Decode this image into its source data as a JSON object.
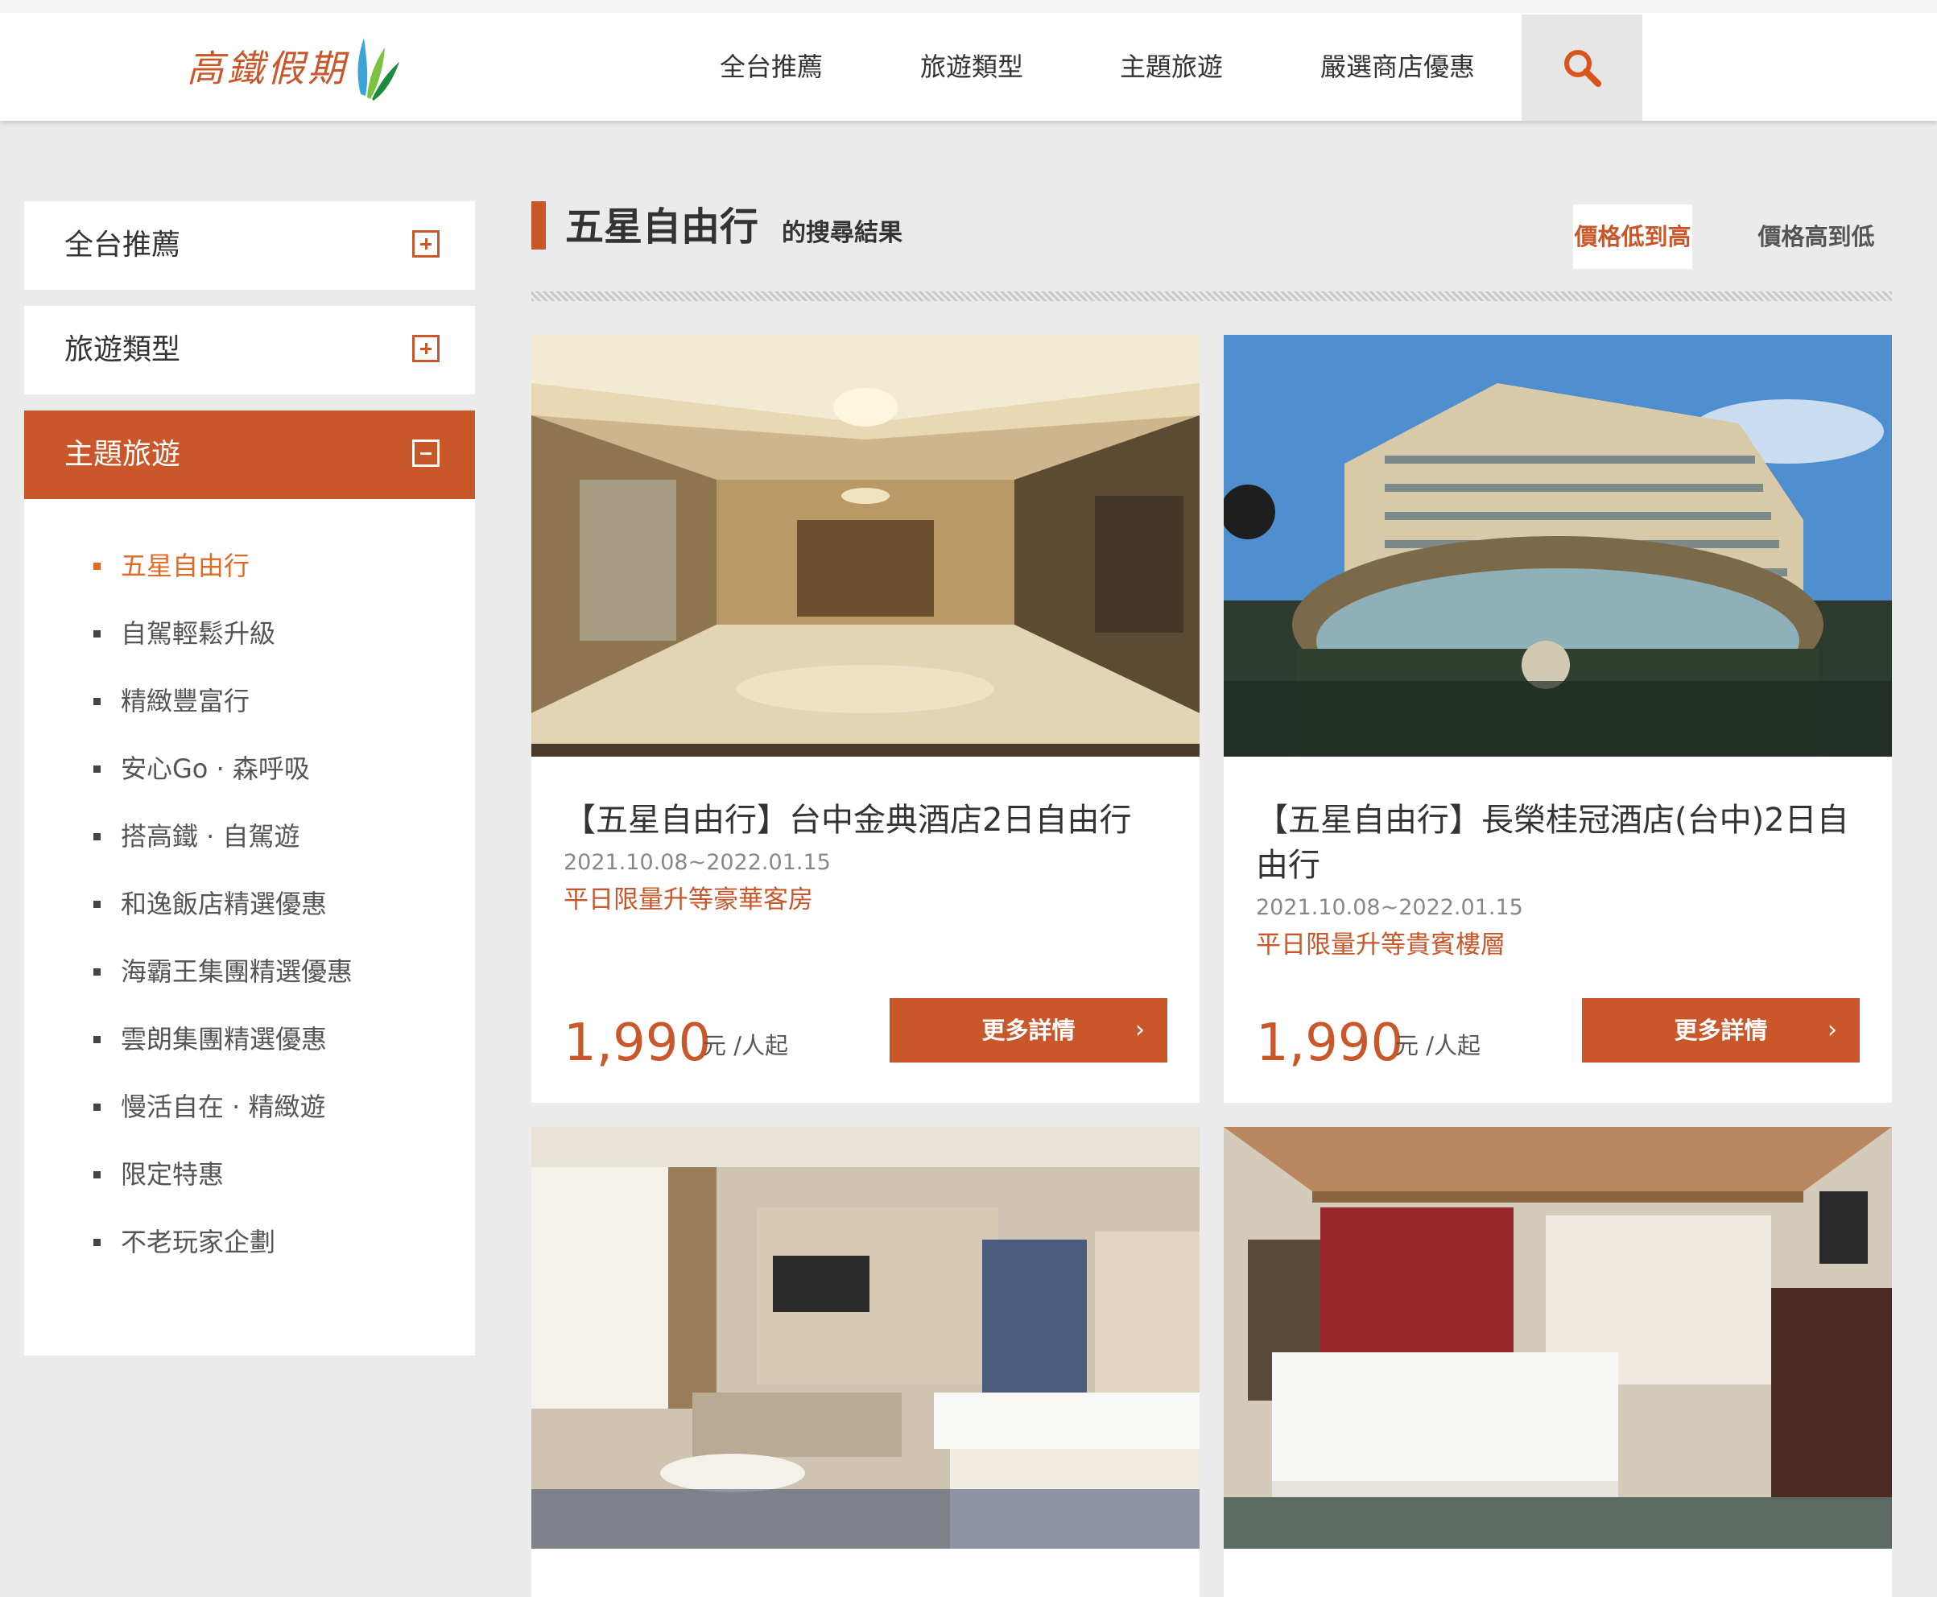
{
  "header": {
    "logo_text": "高鐵假期",
    "nav": [
      "全台推薦",
      "旅遊類型",
      "主題旅遊",
      "嚴選商店優惠"
    ],
    "search_icon": "search-icon",
    "accent_color": "#c9572a"
  },
  "sidebar": {
    "sections": [
      {
        "label": "全台推薦",
        "state": "collapsed"
      },
      {
        "label": "旅遊類型",
        "state": "collapsed"
      },
      {
        "label": "主題旅遊",
        "state": "expanded"
      }
    ],
    "sub_items": [
      "五星自由行",
      "自駕輕鬆升級",
      "精緻豐富行",
      "安心Go · 森呼吸",
      "搭高鐵 · 自駕遊",
      "和逸飯店精選優惠",
      "海霸王集團精選優惠",
      "雲朗集團精選優惠",
      "慢活自在 · 精緻遊",
      "限定特惠",
      "不老玩家企劃"
    ],
    "active_sub_item": "五星自由行"
  },
  "main": {
    "title": "五星自由行",
    "title_suffix": "的搜尋結果",
    "sort": {
      "active": "價格低到高",
      "inactive": "價格高到低"
    },
    "cards": [
      {
        "title": "【五星自由行】台中金典酒店2日自由行",
        "date": "2021.10.08~2022.01.15",
        "promo": "平日限量升等豪華客房",
        "price": "1,990",
        "unit": "元 /人起",
        "button": "更多詳情",
        "photo": "hotel-lobby"
      },
      {
        "title": "【五星自由行】長榮桂冠酒店(台中)2日自由行",
        "date": "2021.10.08~2022.01.15",
        "promo": "平日限量升等貴賓樓層",
        "price": "1,990",
        "unit": "元 /人起",
        "button": "更多詳情",
        "photo": "hotel-building"
      },
      {
        "photo": "twin-room"
      },
      {
        "photo": "king-room"
      }
    ]
  }
}
